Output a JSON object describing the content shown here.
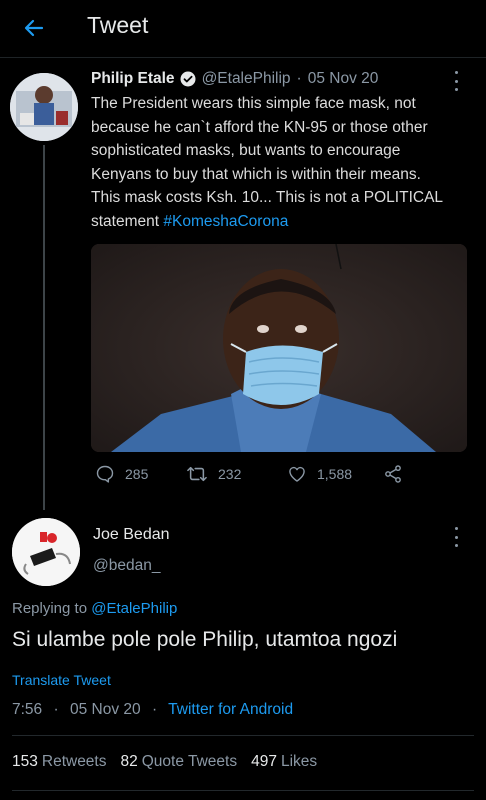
{
  "header": {
    "title": "Tweet",
    "back_icon": "back-arrow-icon"
  },
  "colors": {
    "accent": "#1d9bf0",
    "background": "#000000",
    "muted": "#8b98a5"
  },
  "tweet": {
    "author_name": "Philip Etale",
    "handle": "@EtalePhilip",
    "separator": "·",
    "date": "05 Nov 20",
    "text_lines": [
      "The President wears this simple face mask, not",
      "because he can`t afford the KN-95 or those other",
      "sophisticated masks, but wants to encourage",
      "Kenyans to buy that which is within their means.",
      "This mask costs Ksh. 10... This is not a POLITICAL"
    ],
    "text_last_prefix": "statement ",
    "hashtag": "#KomeshaCorona",
    "reply_count": "285",
    "retweet_count": "232",
    "like_count": "1,588"
  },
  "reply": {
    "author_name": "Joe Bedan",
    "handle": "@bedan_",
    "replying_prefix": "Replying to ",
    "replying_to": "@EtalePhilip",
    "text": "Si ulambe pole pole Philip, utamtoa ngozi",
    "translate_label": "Translate Tweet",
    "time": "7:56",
    "separator": "·",
    "date": "05 Nov 20",
    "source": "Twitter for Android",
    "retweets": "153",
    "retweets_label": "Retweets",
    "quotes": "82",
    "quotes_label": "Quote Tweets",
    "likes": "497",
    "likes_label": "Likes"
  }
}
